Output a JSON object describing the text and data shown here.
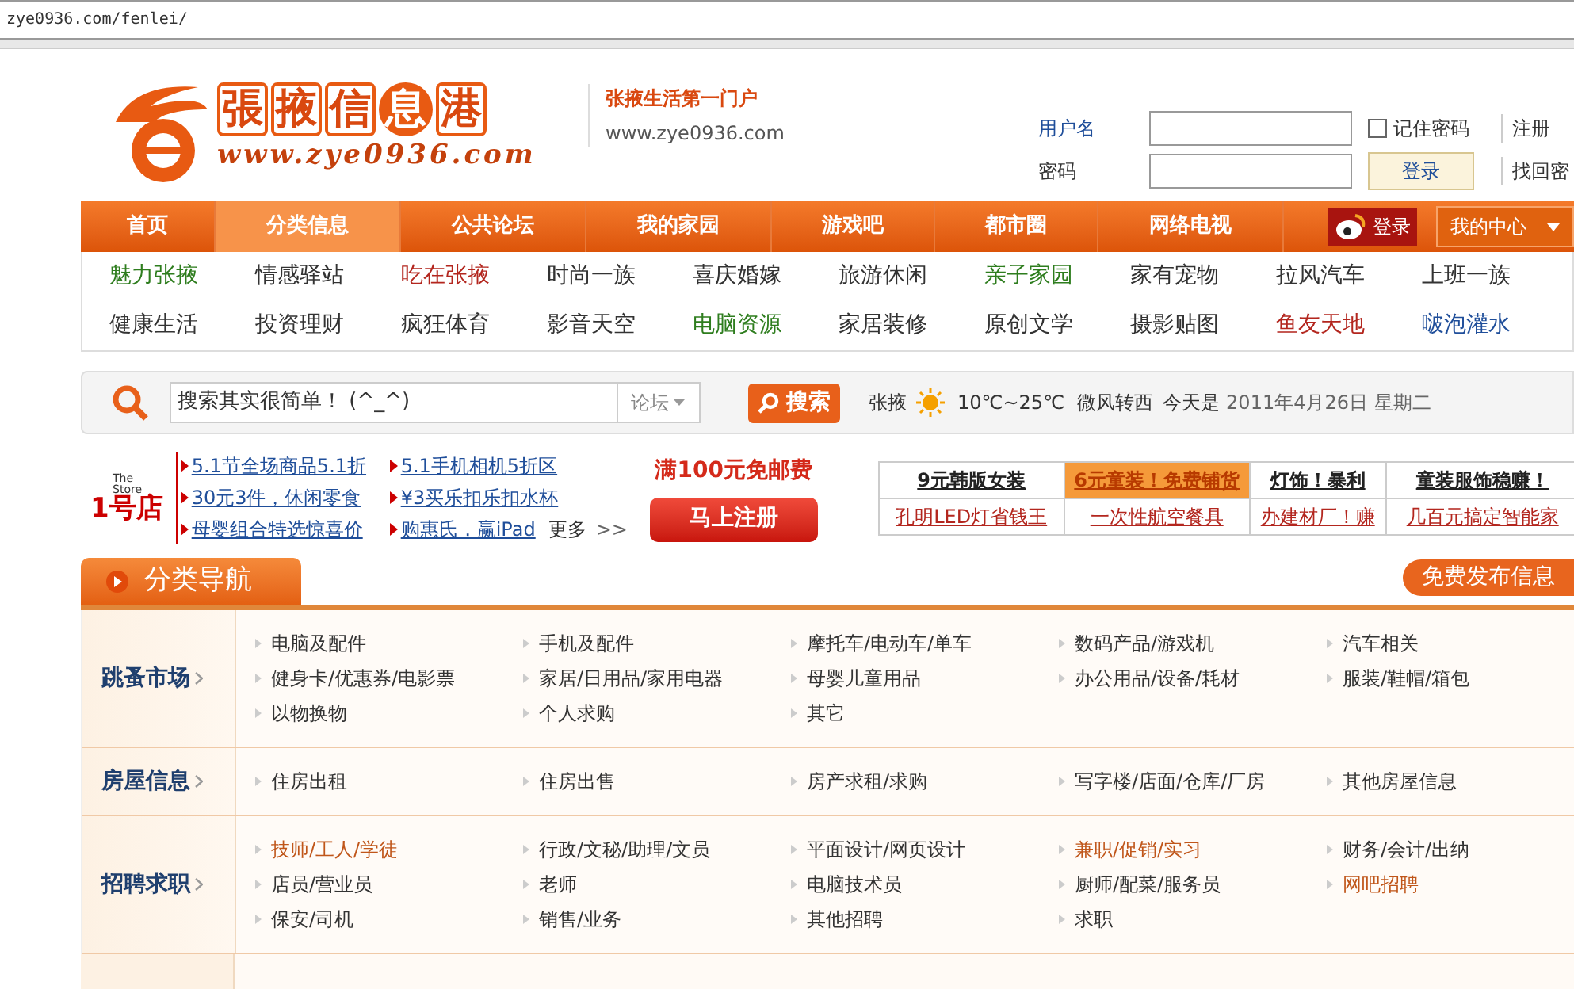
{
  "address_bar": {
    "url": "zye0936.com/fenlei/"
  },
  "header": {
    "logo_text": "張掖信息港",
    "logo_url": "www.zye0936.com",
    "slogan": "张掖生活第一门户",
    "site_url": "www.zye0936.com"
  },
  "login": {
    "username_label": "用户名",
    "password_label": "密码",
    "remember": {
      "label": "记住密码",
      "checked": false
    },
    "login_button": "登录",
    "register_link": "注册",
    "recover_link": "找回密"
  },
  "main_nav": {
    "items": [
      {
        "label": "首页",
        "selected": false
      },
      {
        "label": "分类信息",
        "selected": true
      },
      {
        "label": "公共论坛",
        "selected": false
      },
      {
        "label": "我的家园",
        "selected": false
      },
      {
        "label": "游戏吧",
        "selected": false
      },
      {
        "label": "都市圈",
        "selected": false
      },
      {
        "label": "网络电视",
        "selected": false
      }
    ],
    "weibo_login": "登录",
    "my_center": "我的中心"
  },
  "sub_nav": [
    {
      "label": "魅力张掖",
      "color": "#2e7d1e"
    },
    {
      "label": "情感驿站",
      "color": "#333333"
    },
    {
      "label": "吃在张掖",
      "color": "#b3261e"
    },
    {
      "label": "时尚一族",
      "color": "#333333"
    },
    {
      "label": "喜庆婚嫁",
      "color": "#333333"
    },
    {
      "label": "旅游休闲",
      "color": "#333333"
    },
    {
      "label": "亲子家园",
      "color": "#2e7d1e"
    },
    {
      "label": "家有宠物",
      "color": "#333333"
    },
    {
      "label": "拉风汽车",
      "color": "#333333"
    },
    {
      "label": "上班一族",
      "color": "#333333"
    },
    {
      "label": "健康生活",
      "color": "#333333"
    },
    {
      "label": "投资理财",
      "color": "#333333"
    },
    {
      "label": "疯狂体育",
      "color": "#333333"
    },
    {
      "label": "影音天空",
      "color": "#333333"
    },
    {
      "label": "电脑资源",
      "color": "#2e7d1e"
    },
    {
      "label": "家居装修",
      "color": "#333333"
    },
    {
      "label": "原创文学",
      "color": "#333333"
    },
    {
      "label": "摄影贴图",
      "color": "#333333"
    },
    {
      "label": "鱼友天地",
      "color": "#b3261e"
    },
    {
      "label": "啵泡灌水",
      "color": "#1f4e9a"
    }
  ],
  "search": {
    "value": "搜索其实很简单！  (^_^)",
    "scope": "论坛",
    "button": "搜索"
  },
  "weather": {
    "city": "张掖",
    "temperature": "10℃~25℃",
    "wind": "微风转西",
    "date_prefix": "今天是",
    "date": "2011年4月26日 星期二"
  },
  "promo": {
    "logo_text": "1号店",
    "logo_tag": "The Store",
    "links": [
      "5.1节全场商品5.1折",
      "5.1手机相机5折区",
      "30元3件，休闲零食",
      "¥3买乐扣乐扣水杯",
      "母婴组合特选惊喜价",
      "购惠氏，赢iPad"
    ],
    "more": "更多",
    "more_arrows": ">>",
    "offer": "满100元免邮费",
    "register_button": "马上注册"
  },
  "ads": [
    {
      "label": "9元韩版女装",
      "highlighted": false
    },
    {
      "label": "6元童装！免费铺货",
      "highlighted": true
    },
    {
      "label": "灯饰！暴利",
      "highlighted": false
    },
    {
      "label": "童装服饰稳赚！",
      "highlighted": false
    },
    {
      "label": "孔明LED灯省钱王",
      "highlighted": false
    },
    {
      "label": "一次性航空餐具",
      "highlighted": false
    },
    {
      "label": "办建材厂！赚",
      "highlighted": false
    },
    {
      "label": "几百元搞定智能家",
      "highlighted": false
    }
  ],
  "category_nav": {
    "title": "分类导航",
    "post_button": "免费发布信息",
    "sections": [
      {
        "title": "跳蚤市场",
        "items": [
          {
            "label": "电脑及配件",
            "highlighted": false
          },
          {
            "label": "手机及配件",
            "highlighted": false
          },
          {
            "label": "摩托车/电动车/单车",
            "highlighted": false
          },
          {
            "label": "数码产品/游戏机",
            "highlighted": false
          },
          {
            "label": "汽车相关",
            "highlighted": false
          },
          {
            "label": "健身卡/优惠券/电影票",
            "highlighted": false
          },
          {
            "label": "家居/日用品/家用电器",
            "highlighted": false
          },
          {
            "label": "母婴儿童用品",
            "highlighted": false
          },
          {
            "label": "办公用品/设备/耗材",
            "highlighted": false
          },
          {
            "label": "服装/鞋帽/箱包",
            "highlighted": false
          },
          {
            "label": "以物换物",
            "highlighted": false
          },
          {
            "label": "个人求购",
            "highlighted": false
          },
          {
            "label": "其它",
            "highlighted": false
          }
        ]
      },
      {
        "title": "房屋信息",
        "items": [
          {
            "label": "住房出租",
            "highlighted": false
          },
          {
            "label": "住房出售",
            "highlighted": false
          },
          {
            "label": "房产求租/求购",
            "highlighted": false
          },
          {
            "label": "写字楼/店面/仓库/厂房",
            "highlighted": false
          },
          {
            "label": "其他房屋信息",
            "highlighted": false
          }
        ]
      },
      {
        "title": "招聘求职",
        "items": [
          {
            "label": "技师/工人/学徒",
            "highlighted": true
          },
          {
            "label": "行政/文秘/助理/文员",
            "highlighted": false
          },
          {
            "label": "平面设计/网页设计",
            "highlighted": false
          },
          {
            "label": "兼职/促销/实习",
            "highlighted": true
          },
          {
            "label": "财务/会计/出纳",
            "highlighted": false
          },
          {
            "label": "店员/营业员",
            "highlighted": false
          },
          {
            "label": "老师",
            "highlighted": false
          },
          {
            "label": "电脑技术员",
            "highlighted": false
          },
          {
            "label": "厨师/配菜/服务员",
            "highlighted": false
          },
          {
            "label": "网吧招聘",
            "highlighted": true
          },
          {
            "label": "保安/司机",
            "highlighted": false
          },
          {
            "label": "销售/业务",
            "highlighted": false
          },
          {
            "label": "其他招聘",
            "highlighted": false
          },
          {
            "label": "求职",
            "highlighted": false
          }
        ]
      }
    ]
  }
}
